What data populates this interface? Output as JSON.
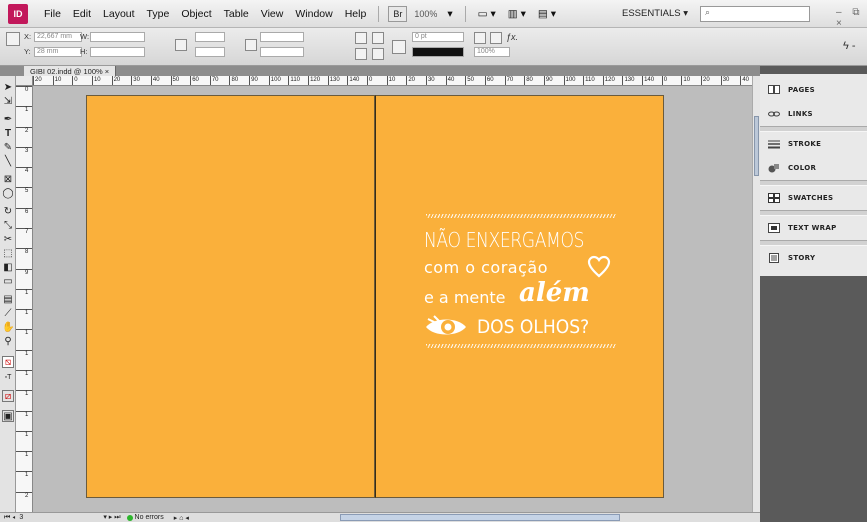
{
  "app": {
    "logo": "ID",
    "menus": [
      "File",
      "Edit",
      "Layout",
      "Type",
      "Object",
      "Table",
      "View",
      "Window",
      "Help"
    ],
    "bridge_label": "Br",
    "zoom": "100%",
    "workspace": "ESSENTIALS",
    "window_controls": "– ⧉ ×"
  },
  "control": {
    "x_label": "X:",
    "x_value": "22,667 mm",
    "y_label": "Y:",
    "y_value": "28 mm",
    "w_label": "W:",
    "h_label": "H:",
    "stroke_weight": "0 pt",
    "scale_percent": "100%"
  },
  "document": {
    "tab_title": "GIBI 02.indd @ 100% ×"
  },
  "ruler": {
    "top_marks": [
      "20",
      "10",
      "0",
      "10",
      "20",
      "30",
      "40",
      "50",
      "60",
      "70",
      "80",
      "90",
      "100",
      "110",
      "120",
      "130",
      "140",
      "0",
      "10",
      "20",
      "30",
      "40",
      "50",
      "60",
      "70",
      "80",
      "90",
      "100",
      "110",
      "120",
      "130",
      "140",
      "0",
      "10",
      "20",
      "30",
      "40"
    ],
    "side_marks": [
      "0",
      "1",
      "2",
      "3",
      "4",
      "5",
      "6",
      "7",
      "8",
      "9",
      "1",
      "1",
      "1",
      "1",
      "1",
      "1",
      "1",
      "1",
      "1",
      "1",
      "2"
    ]
  },
  "artwork": {
    "page_color": "#fab03b",
    "line1": "NÃO ENXERGAMOS",
    "line2": "com o coração",
    "line3a": "e a mente",
    "line3b": "além",
    "line4": "DOS OLHOS?"
  },
  "status": {
    "page": "3",
    "errors": "No errors"
  },
  "panels": [
    {
      "icon": "pages-icon",
      "label": "PAGES"
    },
    {
      "icon": "links-icon",
      "label": "LINKS"
    },
    {
      "icon": "stroke-icon",
      "label": "STROKE"
    },
    {
      "icon": "color-icon",
      "label": "COLOR"
    },
    {
      "icon": "swatches-icon",
      "label": "SWATCHES"
    },
    {
      "icon": "text-wrap-icon",
      "label": "TEXT WRAP"
    },
    {
      "icon": "story-icon",
      "label": "STORY"
    }
  ]
}
